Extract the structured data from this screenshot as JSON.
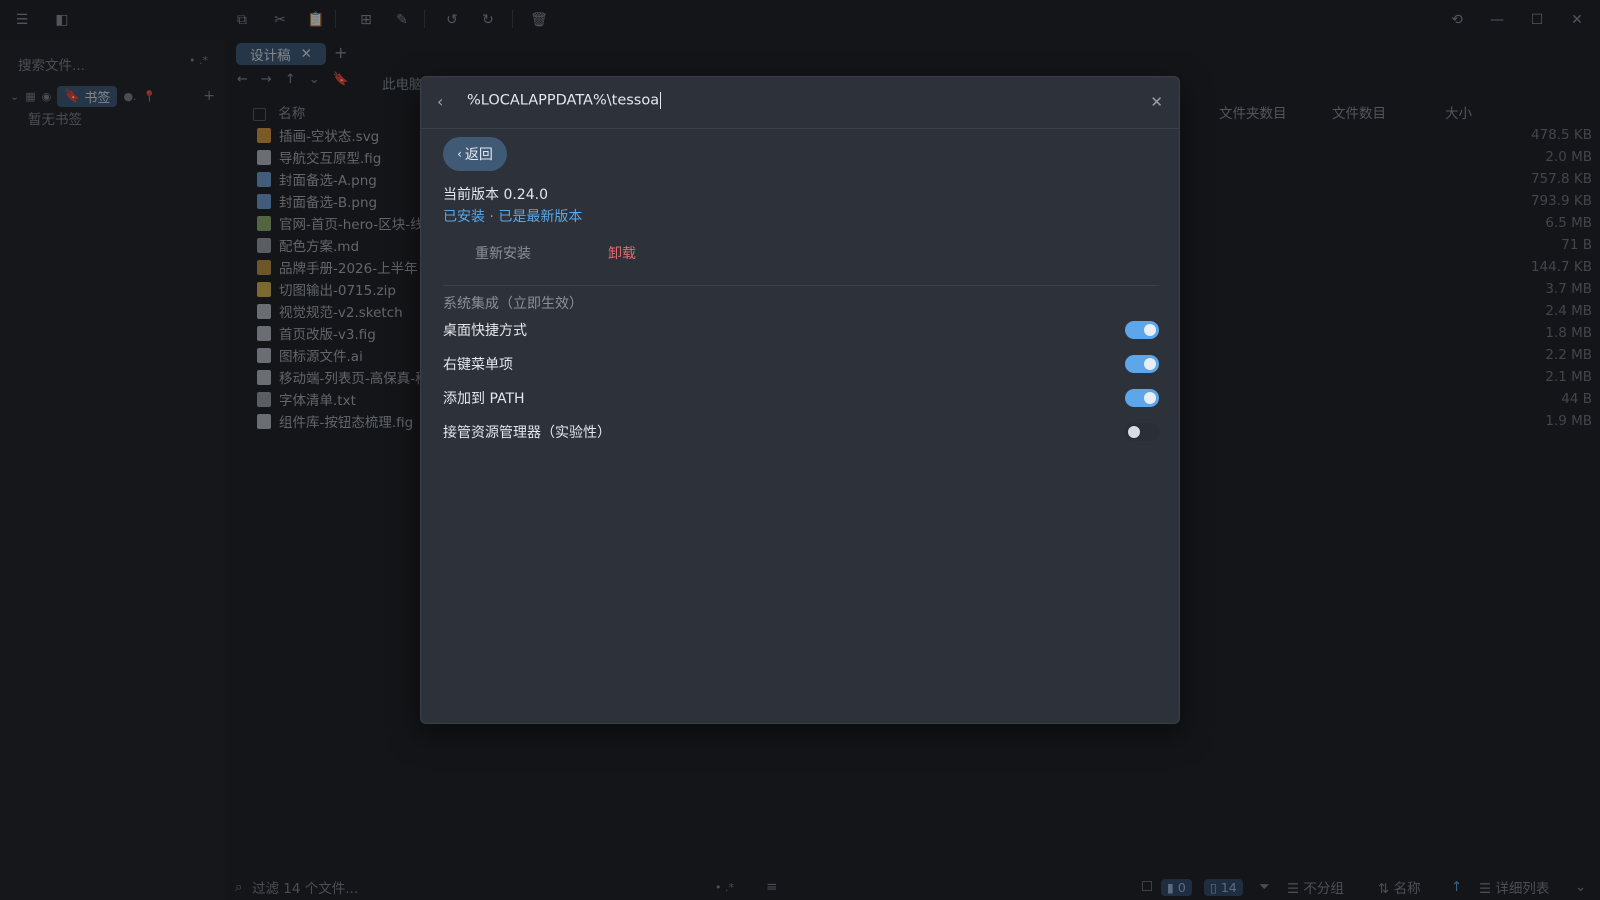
{
  "titlebar": {
    "icons": [
      "menu-icon",
      "panel-icon",
      "copy-icon",
      "cut-icon",
      "paste-icon",
      "new-folder-icon",
      "rename-icon",
      "undo-icon",
      "redo-icon",
      "delete-icon",
      "history-icon"
    ]
  },
  "sidebar": {
    "search_placeholder": "搜索文件...",
    "bookmark_tag": "书签",
    "empty_text": "暂无书签"
  },
  "tabs": [
    {
      "label": "设计稿"
    }
  ],
  "breadcrumb": "此电脑",
  "columns": {
    "name": "名称",
    "folders": "文件夹数目",
    "files": "文件数目",
    "size": "大小"
  },
  "files": [
    {
      "name": "插画-空状态.svg",
      "size": "478.5 KB",
      "icon_color": "#d89a3c"
    },
    {
      "name": "导航交互原型.fig",
      "size": "2.0 MB",
      "icon_color": "#b8bcc2"
    },
    {
      "name": "封面备选-A.png",
      "size": "757.8 KB",
      "icon_color": "#6f9ed6"
    },
    {
      "name": "封面备选-B.png",
      "size": "793.9 KB",
      "icon_color": "#6f9ed6"
    },
    {
      "name": "官网-首页-hero-区块-线框",
      "size": "6.5 MB",
      "icon_color": "#8fb06a"
    },
    {
      "name": "配色方案.md",
      "size": "71 B",
      "icon_color": "#9ba0a6"
    },
    {
      "name": "品牌手册-2026-上半年",
      "size": "144.7 KB",
      "icon_color": "#c0933d"
    },
    {
      "name": "切图输出-0715.zip",
      "size": "3.7 MB",
      "icon_color": "#d7b54a"
    },
    {
      "name": "视觉规范-v2.sketch",
      "size": "2.4 MB",
      "icon_color": "#b8bcc2"
    },
    {
      "name": "首页改版-v3.fig",
      "size": "1.8 MB",
      "icon_color": "#b8bcc2"
    },
    {
      "name": "图标源文件.ai",
      "size": "2.2 MB",
      "icon_color": "#b8bcc2"
    },
    {
      "name": "移动端-列表页-高保真-稿",
      "size": "2.1 MB",
      "icon_color": "#b8bcc2"
    },
    {
      "name": "字体清单.txt",
      "size": "44 B",
      "icon_color": "#9ba0a6"
    },
    {
      "name": "组件库-按钮态梳理.fig",
      "size": "1.9 MB",
      "icon_color": "#b8bcc2"
    }
  ],
  "statusbar": {
    "filter_placeholder": "过滤 14 个文件...",
    "folder_count": "0",
    "file_count": "14",
    "group_label": "不分组",
    "sort_label": "名称",
    "view_label": "详细列表"
  },
  "modal": {
    "path_value": "%LOCALAPPDATA%\\tessoa",
    "return_label": "返回",
    "current_version": "当前版本 0.24.0",
    "install_status": "已安装 · 已是最新版本",
    "reinstall_label": "重新安装",
    "uninstall_label": "卸载",
    "section_title": "系统集成（立即生效）",
    "options": [
      {
        "label": "桌面快捷方式",
        "enabled": true
      },
      {
        "label": "右键菜单项",
        "enabled": true
      },
      {
        "label": "添加到 PATH",
        "enabled": true
      },
      {
        "label": "接管资源管理器（实验性）",
        "enabled": false
      }
    ]
  },
  "colors": {
    "accent": "#5ea6ea",
    "tab": "#3b5878",
    "danger": "#e06970"
  }
}
